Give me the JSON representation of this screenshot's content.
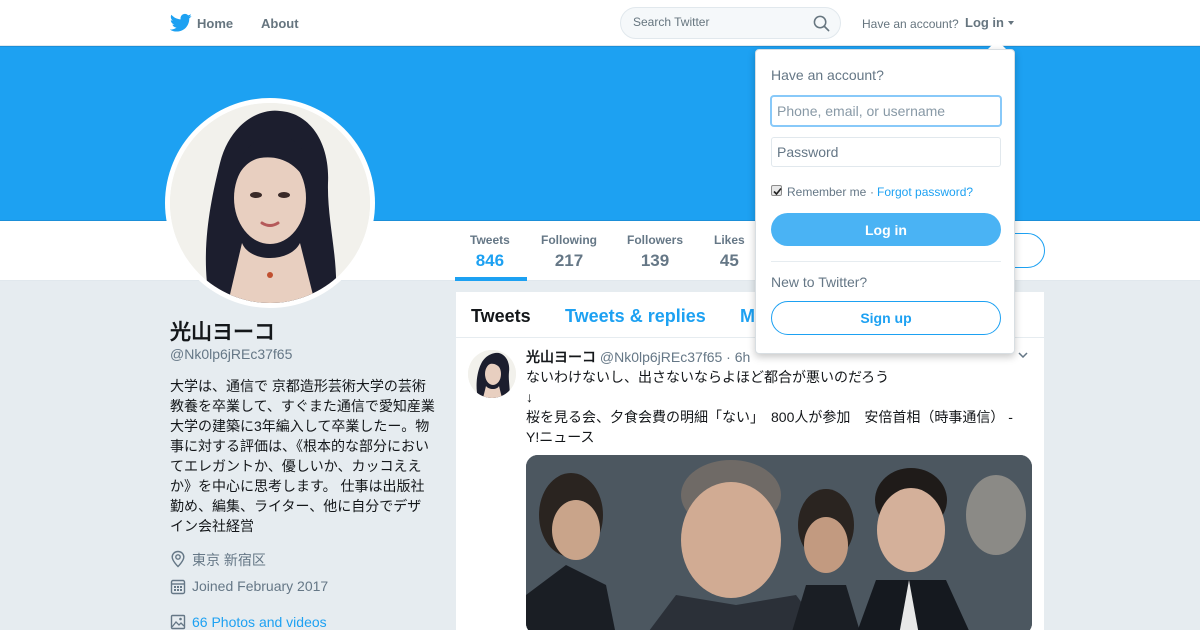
{
  "nav": {
    "home": "Home",
    "about": "About",
    "search_placeholder": "Search Twitter",
    "have_account": "Have an account?",
    "login": "Log in"
  },
  "profile": {
    "name": "光山ヨーコ",
    "handle": "@Nk0lp6jREc37f65",
    "bio": "大学は、通信で 京都造形芸術大学の芸術教養を卒業して、すぐまた通信で愛知産業大学の建築に3年編入して卒業したー。物事に対する評価は、《根本的な部分においてエレガントか、優しいか、カッコええか》を中心に思考します。 仕事は出版社勤め、編集、ライター、他に自分でデザイン会社経営",
    "location": "東京 新宿区",
    "joined": "Joined February 2017",
    "photos": "66 Photos and videos"
  },
  "stats": [
    {
      "label": "Tweets",
      "value": "846"
    },
    {
      "label": "Following",
      "value": "217"
    },
    {
      "label": "Followers",
      "value": "139"
    },
    {
      "label": "Likes",
      "value": "45"
    }
  ],
  "timeline": {
    "tabs": [
      "Tweets",
      "Tweets & replies",
      "M"
    ]
  },
  "tweet": {
    "name": "光山ヨーコ",
    "handle": "@Nk0lp6jREc37f65",
    "time": "· 6h",
    "text_line1": "ないわけないし、出さないならよほど都合が悪いのだろう",
    "text_line2": "↓",
    "text_line3": "桜を見る会、夕食会費の明細「ない」　800人が参加　安倍首相（時事通信） - Y!ニュース"
  },
  "login_dropdown": {
    "title": "Have an account?",
    "username_placeholder": "Phone, email, or username",
    "password_placeholder": "Password",
    "remember_me": "Remember me",
    "separator": "·",
    "forgot_password": "Forgot password?",
    "remember_checked": true,
    "login_button": "Log in",
    "new_to_twitter": "New to Twitter?",
    "signup_button": "Sign up"
  },
  "colors": {
    "brand": "#1da1f2",
    "login_button": "#4ab3f4",
    "background": "#e6ecf0",
    "muted_text": "#657786"
  },
  "icons": [
    "twitter-bird-icon",
    "search-icon",
    "caret-down-icon",
    "location-pin-icon",
    "calendar-icon",
    "photo-icon",
    "chevron-down-icon"
  ]
}
